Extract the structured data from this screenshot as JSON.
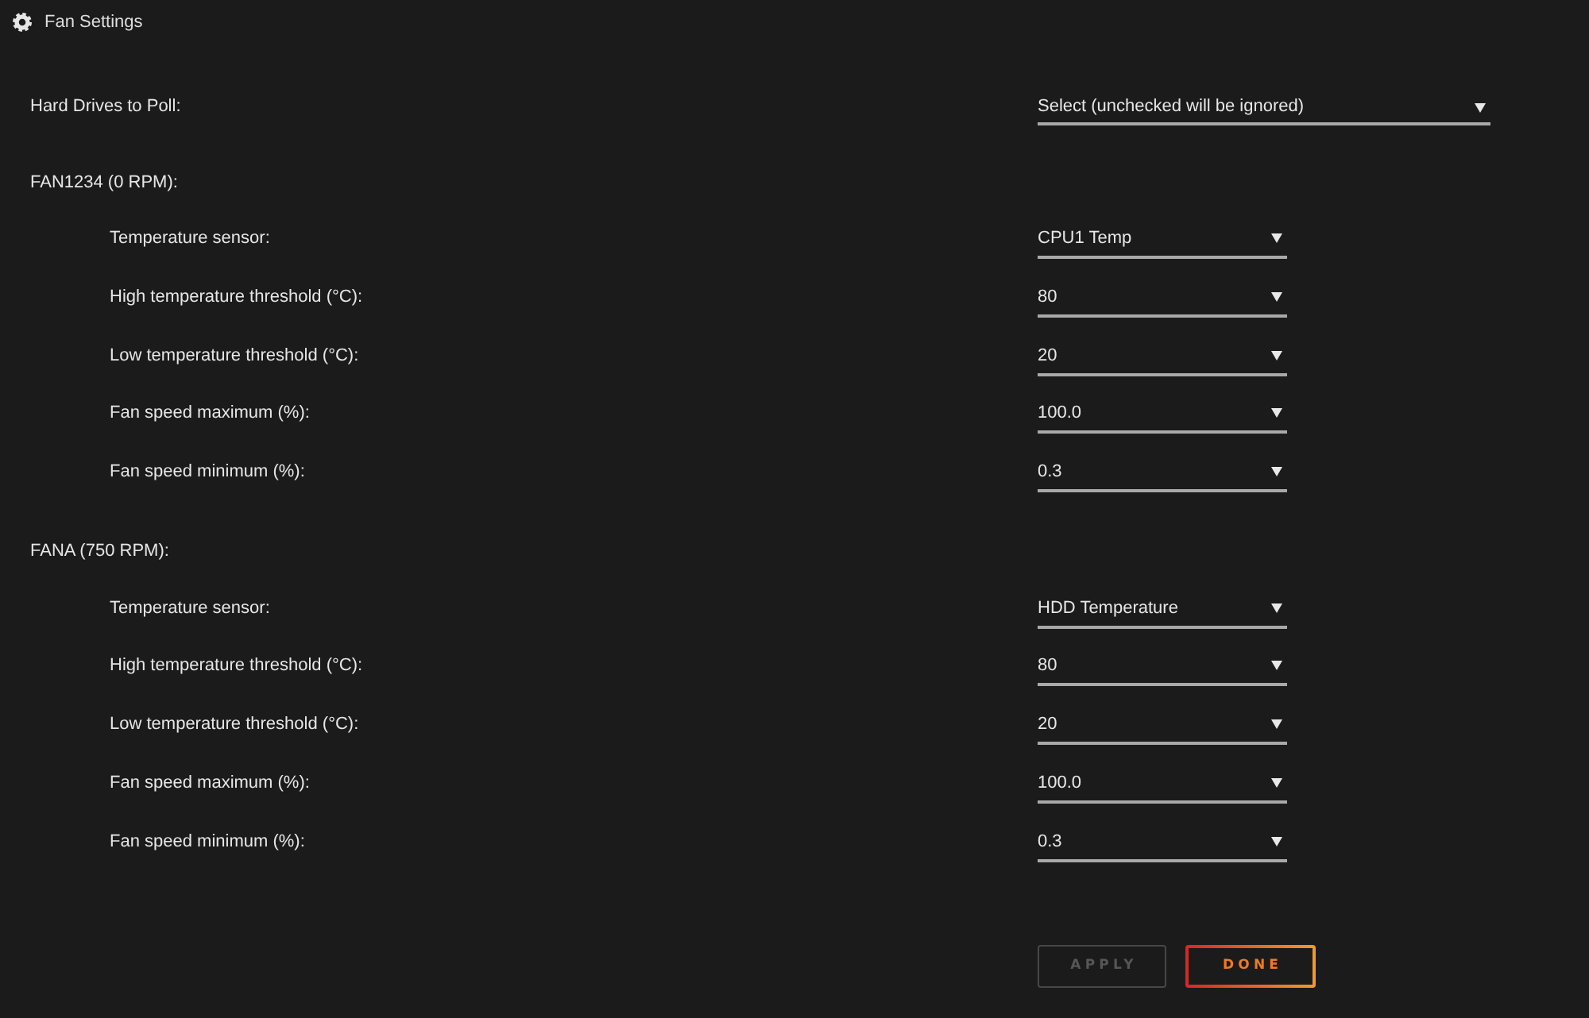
{
  "window": {
    "title": "Fan Settings"
  },
  "hard_drives": {
    "label": "Hard Drives to Poll:",
    "placeholder": "Select (unchecked will be ignored)"
  },
  "fans": [
    {
      "title": "FAN1234 (0 RPM):",
      "settings": [
        {
          "label": "Temperature sensor:",
          "value": "CPU1 Temp"
        },
        {
          "label": "High temperature threshold (°C):",
          "value": "80"
        },
        {
          "label": "Low temperature threshold (°C):",
          "value": "20"
        },
        {
          "label": "Fan speed maximum (%):",
          "value": "100.0"
        },
        {
          "label": "Fan speed minimum (%):",
          "value": "0.3"
        }
      ]
    },
    {
      "title": "FANA (750 RPM):",
      "settings": [
        {
          "label": "Temperature sensor:",
          "value": "HDD Temperature"
        },
        {
          "label": "High temperature threshold (°C):",
          "value": "80"
        },
        {
          "label": "Low temperature threshold (°C):",
          "value": "20"
        },
        {
          "label": "Fan speed maximum (%):",
          "value": "100.0"
        },
        {
          "label": "Fan speed minimum (%):",
          "value": "0.3"
        }
      ]
    }
  ],
  "buttons": [
    {
      "label": "APPLY",
      "disabled": true
    },
    {
      "label": "DONE",
      "disabled": false
    }
  ]
}
